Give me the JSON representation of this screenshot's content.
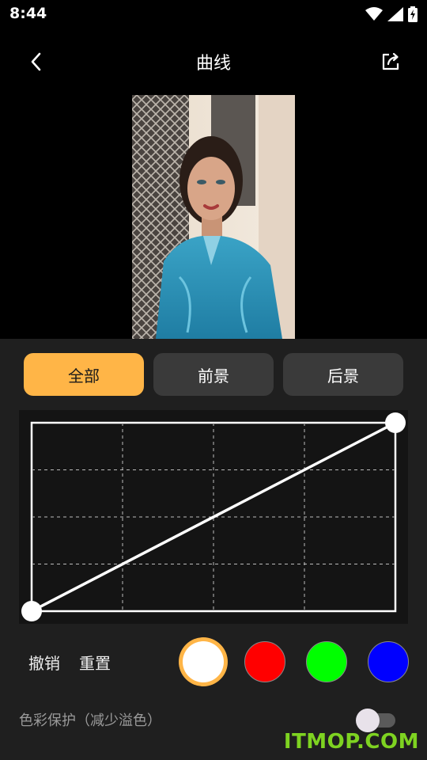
{
  "status": {
    "time": "8:44"
  },
  "header": {
    "title": "曲线"
  },
  "tabs": [
    {
      "label": "全部",
      "active": true
    },
    {
      "label": "前景",
      "active": false
    },
    {
      "label": "后景",
      "active": false
    }
  ],
  "controls": {
    "undo_label": "撤销",
    "reset_label": "重置"
  },
  "channels": [
    {
      "name": "white",
      "color": "#ffffff",
      "selected": true
    },
    {
      "name": "red",
      "color": "#ff0000",
      "selected": false
    },
    {
      "name": "green",
      "color": "#00ff00",
      "selected": false
    },
    {
      "name": "blue",
      "color": "#0000ff",
      "selected": false
    }
  ],
  "protect": {
    "label": "色彩保护（减少溢色）",
    "enabled": false
  },
  "watermark": "ITMOP.COM",
  "colors": {
    "accent": "#ffb547",
    "panel": "#1f1f1f",
    "tab_inactive": "#3a3a3a"
  }
}
